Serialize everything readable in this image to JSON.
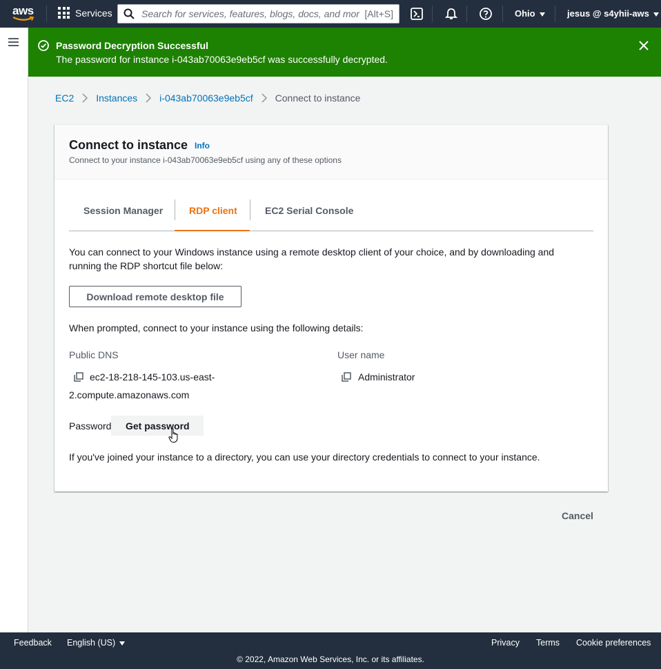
{
  "topnav": {
    "logo_text": "aws",
    "services_label": "Services",
    "search_placeholder": "Search for services, features, blogs, docs, and mor",
    "search_shortcut": "[Alt+S]",
    "region_label": "Ohio",
    "account_label": "jesus @ s4yhii-aws",
    "icons": [
      "cloudshell-icon",
      "bell-icon",
      "help-icon"
    ]
  },
  "flash": {
    "title": "Password Decryption Successful",
    "message": "The password for instance i-043ab70063e9eb5cf was successfully decrypted.",
    "color": "#1d8102"
  },
  "breadcrumb": {
    "items": [
      "EC2",
      "Instances",
      "i-043ab70063e9eb5cf"
    ],
    "current": "Connect to instance"
  },
  "panel": {
    "title": "Connect to instance",
    "info_label": "Info",
    "description": "Connect to your instance i-043ab70063e9eb5cf using any of these options",
    "tabs": [
      {
        "label": "Session Manager",
        "active": false
      },
      {
        "label": "RDP client",
        "active": true
      },
      {
        "label": "EC2 Serial Console",
        "active": false
      }
    ],
    "intro_line1": "You can connect to your Windows instance using a remote desktop client of your choice, and by downloading and",
    "intro_line2": "running the RDP shortcut file below:",
    "download_button": "Download remote desktop file",
    "prompt_text": "When prompted, connect to your instance using the following details:",
    "public_dns_label": "Public DNS",
    "public_dns_line1": "ec2-18-218-145-103.us-east-",
    "public_dns_line2": "2.compute.amazonaws.com",
    "username_label": "User name",
    "username_value": "Administrator",
    "password_label": "Password",
    "get_password_button": "Get password",
    "directory_text": "If you've joined your instance to a directory, you can use your directory credentials to connect to your instance."
  },
  "cancel_button": "Cancel",
  "footer": {
    "feedback": "Feedback",
    "language": "English (US)",
    "privacy": "Privacy",
    "terms": "Terms",
    "cookie_preferences": "Cookie preferences",
    "copyright": "© 2022, Amazon Web Services, Inc. or its affiliates."
  },
  "colors": {
    "nav_bg": "#232f3e",
    "link": "#0073bb",
    "active_tab": "#ec7211",
    "success": "#1d8102"
  }
}
